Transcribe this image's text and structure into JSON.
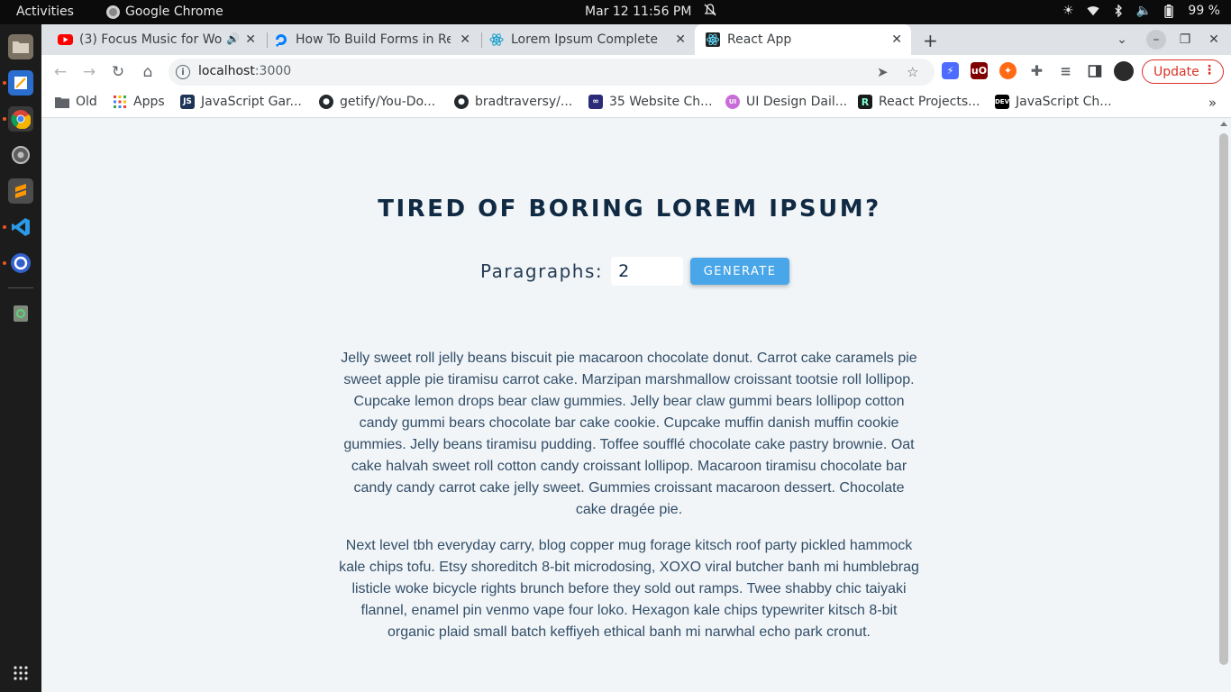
{
  "system": {
    "activities_label": "Activities",
    "app_name": "Google Chrome",
    "clock": "Mar 12  11:56 PM",
    "battery": "99 %"
  },
  "tabs": [
    {
      "title": "(3) Focus Music for Wo",
      "active": false
    },
    {
      "title": "How To Build Forms in Re",
      "active": false
    },
    {
      "title": "Lorem Ipsum Complete",
      "active": false
    },
    {
      "title": "React App",
      "active": true
    }
  ],
  "address_bar": {
    "host": "localhost",
    "port": ":3000"
  },
  "update_button": {
    "label": "Update"
  },
  "bookmarks": [
    {
      "label": "Old"
    },
    {
      "label": "Apps"
    },
    {
      "label": "JavaScript Gar..."
    },
    {
      "label": "getify/You-Do..."
    },
    {
      "label": "bradtraversy/..."
    },
    {
      "label": "35 Website Ch..."
    },
    {
      "label": "UI Design Dail..."
    },
    {
      "label": "React Projects..."
    },
    {
      "label": "JavaScript Ch..."
    }
  ],
  "page": {
    "title": "TIRED OF BORING LOREM IPSUM?",
    "form": {
      "label": "Paragraphs:",
      "value": "2",
      "button_label": "GENERATE"
    },
    "paragraphs": [
      "Jelly sweet roll jelly beans biscuit pie macaroon chocolate donut. Carrot cake caramels pie sweet apple pie tiramisu carrot cake. Marzipan marshmallow croissant tootsie roll lollipop. Cupcake lemon drops bear claw gummies. Jelly bear claw gummi bears lollipop cotton candy gummi bears chocolate bar cake cookie. Cupcake muffin danish muffin cookie gummies. Jelly beans tiramisu pudding. Toffee soufflé chocolate cake pastry brownie. Oat cake halvah sweet roll cotton candy croissant lollipop. Macaroon tiramisu chocolate bar candy candy carrot cake jelly sweet. Gummies croissant macaroon dessert. Chocolate cake dragée pie.",
      "Next level tbh everyday carry, blog copper mug forage kitsch roof party pickled hammock kale chips tofu. Etsy shoreditch 8-bit microdosing, XOXO viral butcher banh mi humblebrag listicle woke bicycle rights brunch before they sold out ramps. Twee shabby chic taiyaki flannel, enamel pin venmo vape four loko. Hexagon kale chips typewriter kitsch 8-bit organic plaid small batch keffiyeh ethical banh mi narwhal echo park cronut."
    ]
  },
  "colors": {
    "title": "#102a43",
    "button": "#49a6e9",
    "page_bg": "#f1f5f8",
    "text": "#334e68"
  }
}
